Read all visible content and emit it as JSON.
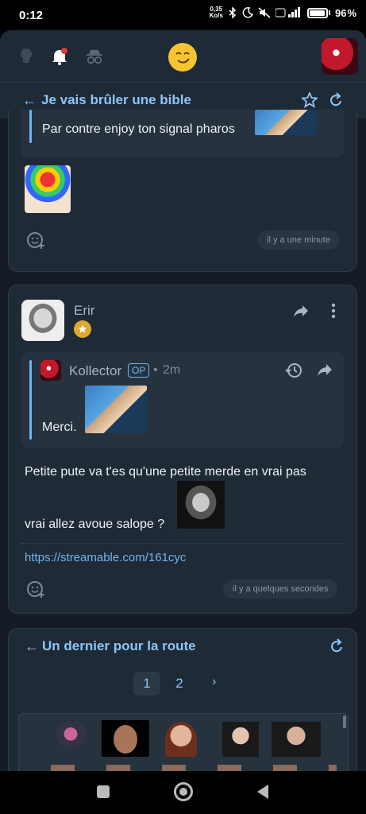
{
  "status": {
    "time": "0:12",
    "netspeed_value": "0,35",
    "netspeed_unit": "Ko/s",
    "battery": "96"
  },
  "topic": {
    "title": "Je vais brûler une bible"
  },
  "post1": {
    "quote_text": "Par contre enjoy ton signal pharos",
    "time": "il y a une minute"
  },
  "post2": {
    "author": "Erir",
    "quote_author": "Kollector",
    "quote_badge": "OP",
    "quote_time": "2m",
    "quote_text": "Merci.",
    "body_line1": "Petite pute va t'es qu'une petite merde en vrai pas",
    "body_line2": "vrai allez avoue salope ?",
    "link": "https://streamable.com/161cyc",
    "time": "il y a quelques secondes"
  },
  "panel": {
    "title": "Un dernier pour la route",
    "pages": [
      "1",
      "2"
    ]
  },
  "icons": [
    "lightbulb-icon",
    "bell-icon",
    "incognito-icon",
    "star-icon",
    "refresh-icon",
    "share-icon",
    "more-icon",
    "history-icon",
    "add-reaction-icon"
  ],
  "colors": {
    "accent": "#8cc6f7",
    "background": "#151c25",
    "card": "#1f2a37"
  }
}
